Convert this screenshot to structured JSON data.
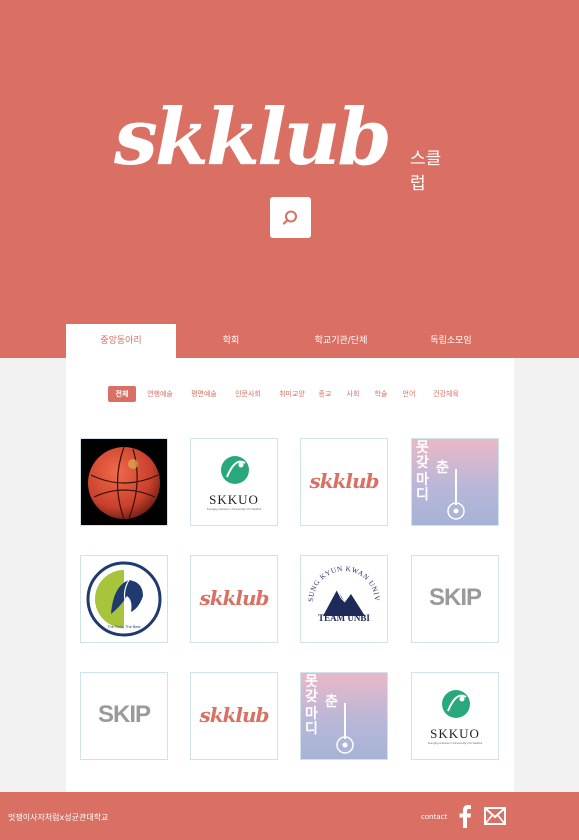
{
  "brand": {
    "logo_text": "skklub",
    "logo_sub": "스클럽"
  },
  "tabs": [
    {
      "label": "중앙동아리",
      "active": true
    },
    {
      "label": "학회",
      "active": false
    },
    {
      "label": "학교기관/단체",
      "active": false
    },
    {
      "label": "독립소모임",
      "active": false
    }
  ],
  "filters": [
    {
      "label": "전체",
      "active": true
    },
    {
      "label": "연행예술"
    },
    {
      "label": "평면예술"
    },
    {
      "label": "인문사회"
    },
    {
      "label": "취미교양"
    },
    {
      "label": "종교"
    },
    {
      "label": "사회"
    },
    {
      "label": "학술"
    },
    {
      "label": "언어"
    },
    {
      "label": "건강체육"
    }
  ],
  "cards": [
    {
      "kind": "basketball-logo"
    },
    {
      "kind": "skkuo-logo",
      "title": "SKKUO",
      "small": "Sungkyunkwan University Orchestra"
    },
    {
      "kind": "skklub-logo",
      "text": "skklub"
    },
    {
      "kind": "motgatchun-logo",
      "text_a": "못갖",
      "text_b": "춘",
      "text_c": "마디"
    },
    {
      "kind": "lion-logo",
      "caption": "The Only, The Best"
    },
    {
      "kind": "skklub-logo",
      "text": "skklub"
    },
    {
      "kind": "team-unbi-logo",
      "arc": "SUNG KYUN KWAN UNIVERSITY",
      "title": "TEAM UNBI"
    },
    {
      "kind": "skip-logo",
      "text": "SKIP"
    },
    {
      "kind": "skip-logo",
      "text": "SKIP"
    },
    {
      "kind": "skklub-logo",
      "text": "skklub"
    },
    {
      "kind": "motgatchun-logo",
      "text_a": "못갖",
      "text_b": "춘",
      "text_c": "마디"
    },
    {
      "kind": "skkuo-logo",
      "title": "SKKUO",
      "small": "Sungkyunkwan University Orchestra"
    }
  ],
  "footer": {
    "text": "멋쟁이사자처럼x성균관대학교",
    "contact_label": "contact"
  },
  "colors": {
    "brand": "#d97063",
    "card_border": "#cfe3ea"
  },
  "icons": {
    "search": "search-icon",
    "facebook": "facebook-icon",
    "mail": "mail-icon"
  }
}
